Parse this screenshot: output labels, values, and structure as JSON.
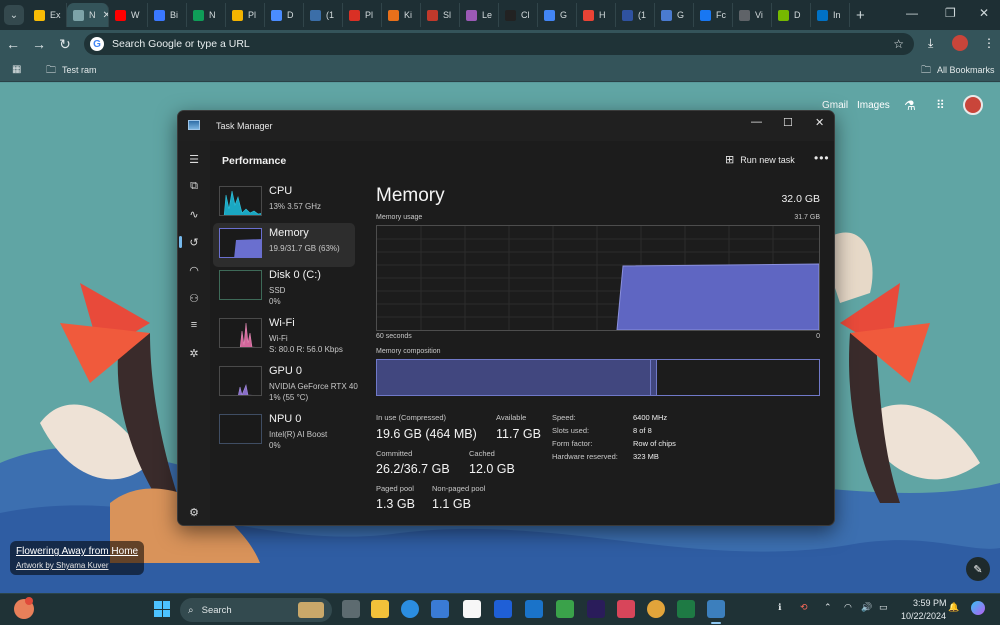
{
  "browser": {
    "tabs": [
      {
        "label": "Ex",
        "color": "#f9bc05"
      },
      {
        "label": "N",
        "color": "#7da3a8",
        "active": true
      },
      {
        "label": "W",
        "color": "#ff0000"
      },
      {
        "label": "Bi",
        "color": "#3a78ff"
      },
      {
        "label": "N",
        "color": "#0f9d58"
      },
      {
        "label": "Pl",
        "color": "#f4b400"
      },
      {
        "label": "D",
        "color": "#4a8cff"
      },
      {
        "label": "(1",
        "color": "#3b6ea8"
      },
      {
        "label": "Pl",
        "color": "#d93025"
      },
      {
        "label": "Ki",
        "color": "#e8701a"
      },
      {
        "label": "Sl",
        "color": "#c0392b"
      },
      {
        "label": "Le",
        "color": "#9b59b6"
      },
      {
        "label": "Cl",
        "color": "#222222"
      },
      {
        "label": "G",
        "color": "#4285f4"
      },
      {
        "label": "H",
        "color": "#ea4335"
      },
      {
        "label": "(1",
        "color": "#2f52a0"
      },
      {
        "label": "G",
        "color": "#4a7bd0"
      },
      {
        "label": "Fc",
        "color": "#1877f2"
      },
      {
        "label": "Vi",
        "color": "#5f6368"
      },
      {
        "label": "D",
        "color": "#76b900"
      },
      {
        "label": "In",
        "color": "#0071c5"
      }
    ],
    "omnibox_placeholder": "Search Google or type a URL",
    "bookmark_folder": "Test ram",
    "all_bookmarks": "All Bookmarks",
    "ntp_links": {
      "gmail": "Gmail",
      "images": "Images"
    },
    "artwork": {
      "title": "Flowering Away from Home",
      "credit": "Artwork by Shyama Kuver"
    }
  },
  "task_manager": {
    "window_title": "Task Manager",
    "section_title": "Performance",
    "run_new_task": "Run new task",
    "list": [
      {
        "name": "CPU",
        "sub1": "13%  3.57 GHz",
        "sub2": ""
      },
      {
        "name": "Memory",
        "sub1": "19.9/31.7 GB (63%)",
        "sub2": "",
        "selected": true
      },
      {
        "name": "Disk 0 (C:)",
        "sub1": "SSD",
        "sub2": "0%"
      },
      {
        "name": "Wi-Fi",
        "sub1": "Wi-Fi",
        "sub2": "S: 80.0  R: 56.0 Kbps"
      },
      {
        "name": "GPU 0",
        "sub1": "NVIDIA GeForce RTX 40",
        "sub2": "1%  (55 °C)"
      },
      {
        "name": "NPU 0",
        "sub1": "Intel(R) AI Boost",
        "sub2": "0%"
      }
    ],
    "memory": {
      "title": "Memory",
      "total": "32.0 GB",
      "usage_label": "Memory usage",
      "usage_max": "31.7 GB",
      "time_left": "60 seconds",
      "time_right": "0",
      "composition_label": "Memory composition",
      "in_use_fraction": 0.62,
      "in_use_label": "In use (Compressed)",
      "in_use_value": "19.6 GB (464 MB)",
      "available_label": "Available",
      "available_value": "11.7 GB",
      "committed_label": "Committed",
      "committed_value": "26.2/36.7 GB",
      "cached_label": "Cached",
      "cached_value": "12.0 GB",
      "paged_label": "Paged pool",
      "paged_value": "1.3 GB",
      "nonpaged_label": "Non-paged pool",
      "nonpaged_value": "1.1 GB",
      "speed_label": "Speed:",
      "speed_value": "6400 MHz",
      "slots_label": "Slots used:",
      "slots_value": "8 of 8",
      "form_label": "Form factor:",
      "form_value": "Row of chips",
      "reserved_label": "Hardware reserved:",
      "reserved_value": "323 MB"
    }
  },
  "taskbar": {
    "search_placeholder": "Search",
    "time": "3:59 PM",
    "date": "10/22/2024"
  }
}
